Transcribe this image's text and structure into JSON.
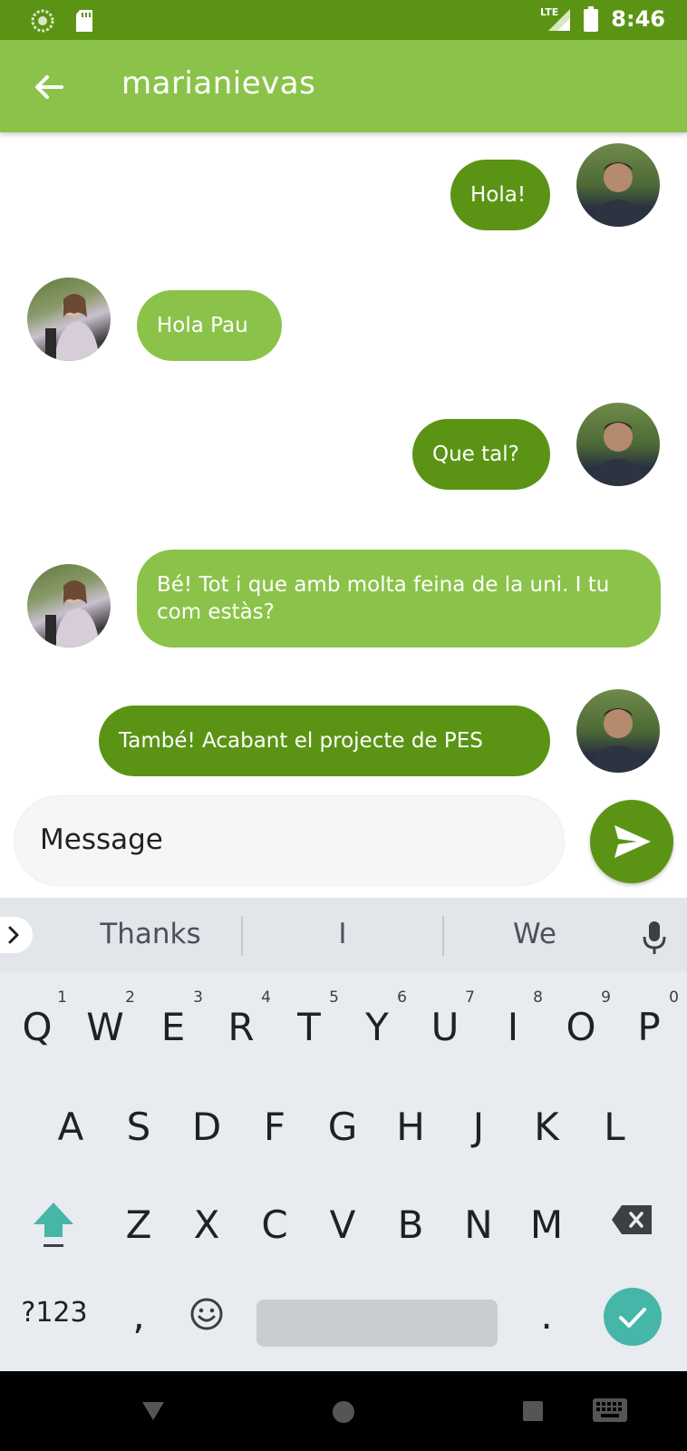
{
  "status_bar": {
    "network": "LTE",
    "time": "8:46"
  },
  "app_bar": {
    "title": "marianievas"
  },
  "messages": [
    {
      "sender": "me",
      "text": "Hola!"
    },
    {
      "sender": "other",
      "text": "Hola Pau"
    },
    {
      "sender": "me",
      "text": "Que tal?"
    },
    {
      "sender": "other",
      "text": "Bé! Tot i que amb molta feina de la uni. I tu com estàs?"
    },
    {
      "sender": "me",
      "text": "També! Acabant el projecte de PES"
    }
  ],
  "composer": {
    "placeholder": "Message"
  },
  "keyboard": {
    "suggestions": [
      "Thanks",
      "I",
      "We"
    ],
    "row1": [
      {
        "key": "Q",
        "num": "1"
      },
      {
        "key": "W",
        "num": "2"
      },
      {
        "key": "E",
        "num": "3"
      },
      {
        "key": "R",
        "num": "4"
      },
      {
        "key": "T",
        "num": "5"
      },
      {
        "key": "Y",
        "num": "6"
      },
      {
        "key": "U",
        "num": "7"
      },
      {
        "key": "I",
        "num": "8"
      },
      {
        "key": "O",
        "num": "9"
      },
      {
        "key": "P",
        "num": "0"
      }
    ],
    "row2": [
      "A",
      "S",
      "D",
      "F",
      "G",
      "H",
      "J",
      "K",
      "L"
    ],
    "row3": [
      "Z",
      "X",
      "C",
      "V",
      "B",
      "N",
      "M"
    ],
    "symbols_label": "?123",
    "comma": ",",
    "period": "."
  },
  "colors": {
    "status_bar": "#5b9415",
    "app_bar": "#8bc34a",
    "sent_bubble": "#5b9415",
    "received_bubble": "#8bc34a",
    "keyboard_bg": "#e8ebef",
    "enter_key": "#45b6a8"
  }
}
